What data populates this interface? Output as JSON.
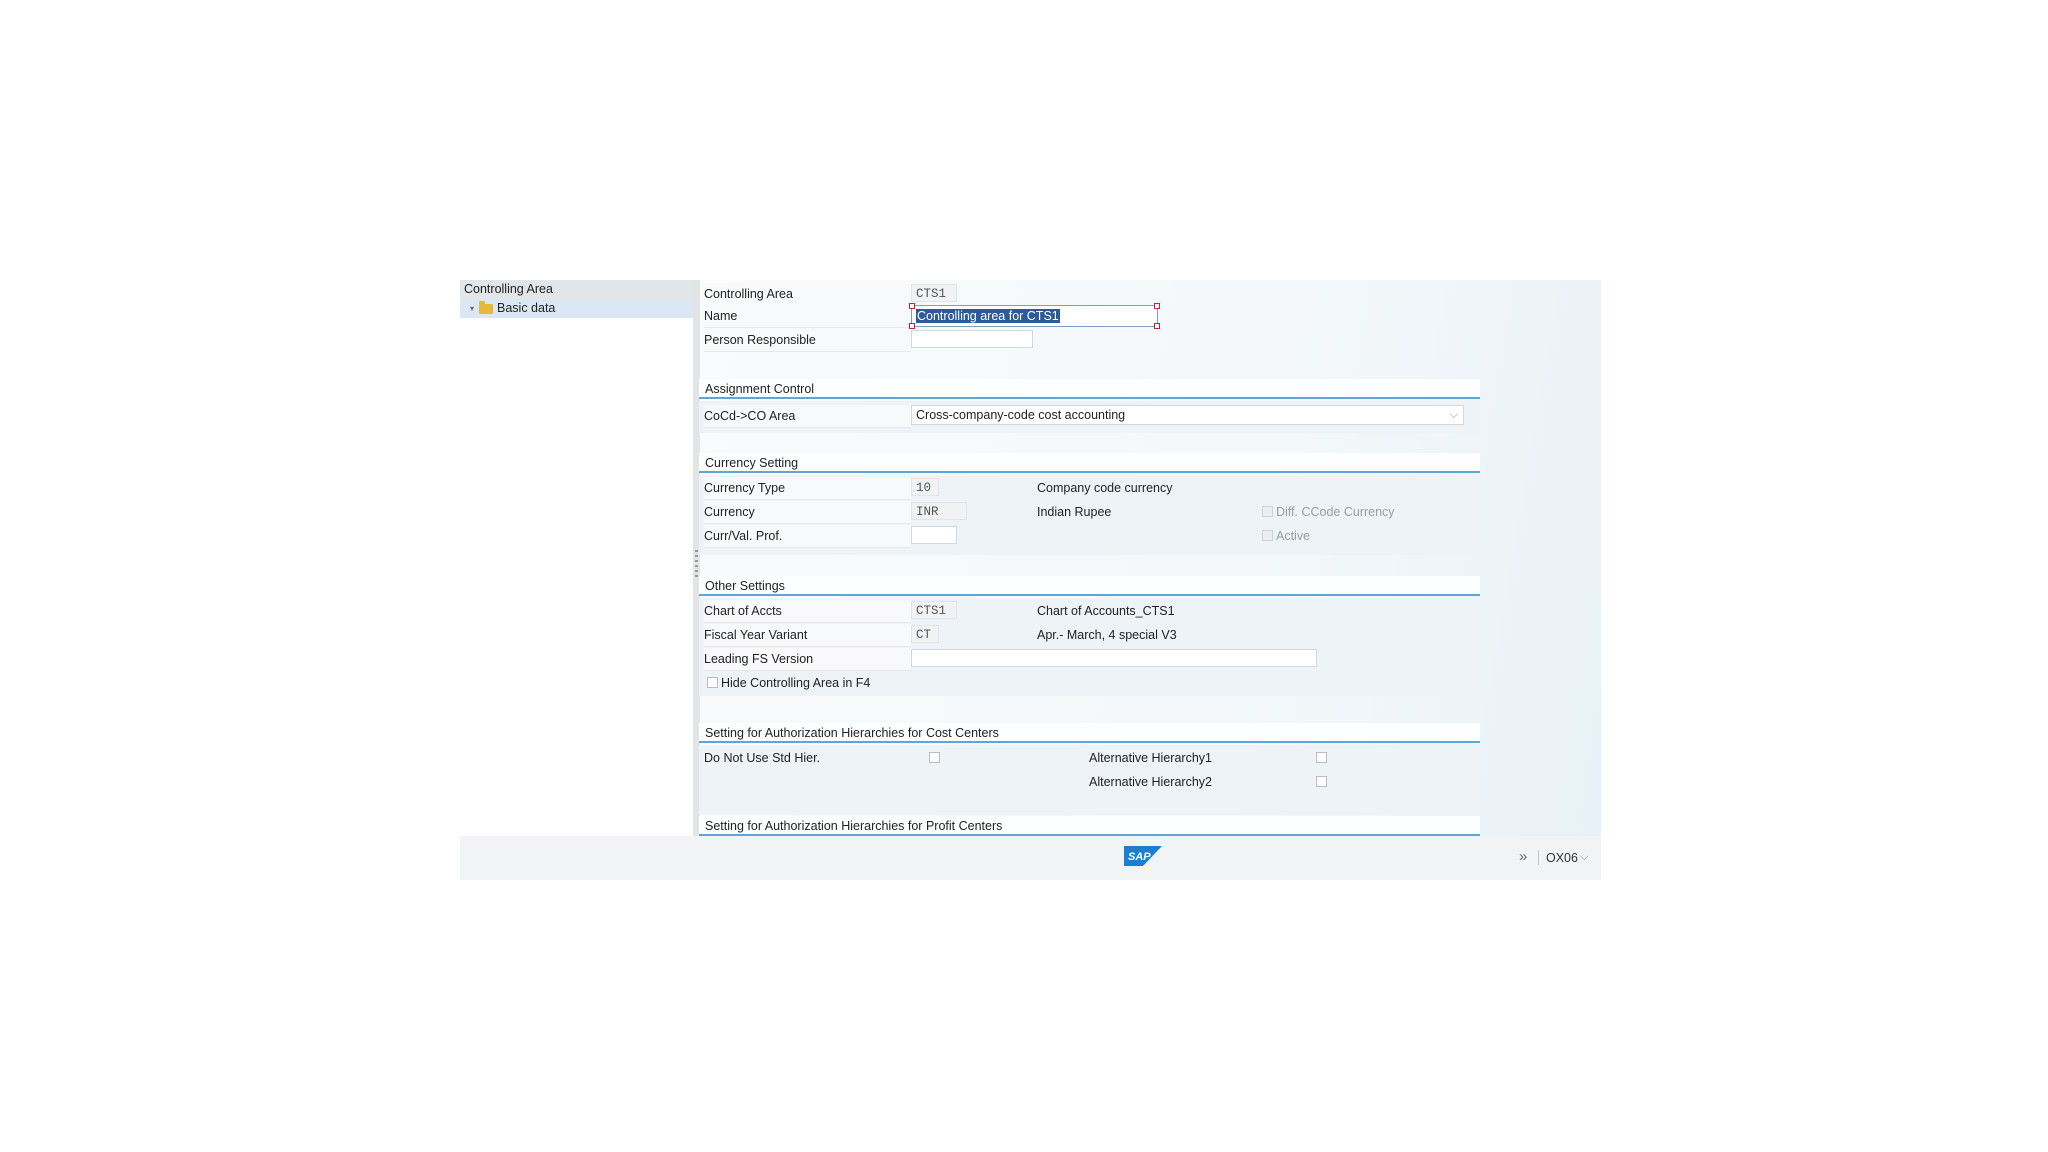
{
  "tree": {
    "root_label": "Controlling Area",
    "node_label": "Basic data"
  },
  "fields": {
    "controlling_area": {
      "label": "Controlling Area",
      "value": "CTS1"
    },
    "name": {
      "label": "Name",
      "value": "Controlling area for CTS1"
    },
    "person_responsible": {
      "label": "Person Responsible",
      "value": ""
    }
  },
  "assignment_control": {
    "title": "Assignment Control",
    "cocd_label": "CoCd->CO Area",
    "cocd_value": "Cross-company-code cost accounting"
  },
  "currency_setting": {
    "title": "Currency Setting",
    "currency_type_label": "Currency Type",
    "currency_type_value": "10",
    "currency_type_desc": "Company code currency",
    "currency_label": "Currency",
    "currency_value": "INR",
    "currency_desc": "Indian Rupee",
    "diff_ccode_label": "Diff. CCode Currency",
    "curr_val_label": "Curr/Val. Prof.",
    "curr_val_value": "",
    "active_label": "Active"
  },
  "other_settings": {
    "title": "Other Settings",
    "chart_label": "Chart of Accts",
    "chart_value": "CTS1",
    "chart_desc": "Chart of Accounts_CTS1",
    "fy_label": "Fiscal Year Variant",
    "fy_value": "CT",
    "fy_desc": "Apr.- March, 4 special V3",
    "leading_fs_label": "Leading FS Version",
    "leading_fs_value": "",
    "hide_label": "Hide Controlling Area in F4"
  },
  "auth_cost_centers": {
    "title": "Setting for Authorization Hierarchies for Cost Centers",
    "do_not_use_label": "Do Not Use Std Hier.",
    "alt1_label": "Alternative Hierarchy1",
    "alt2_label": "Alternative Hierarchy2"
  },
  "auth_profit_centers": {
    "title": "Setting for Authorization Hierarchies for Profit Centers"
  },
  "footer": {
    "logo_text": "SAP",
    "transaction": "OX06"
  },
  "colors": {
    "section_underline": "#5fa6d6",
    "selection": "#2d5b9a",
    "sap_blue": "#1a7fd1"
  }
}
